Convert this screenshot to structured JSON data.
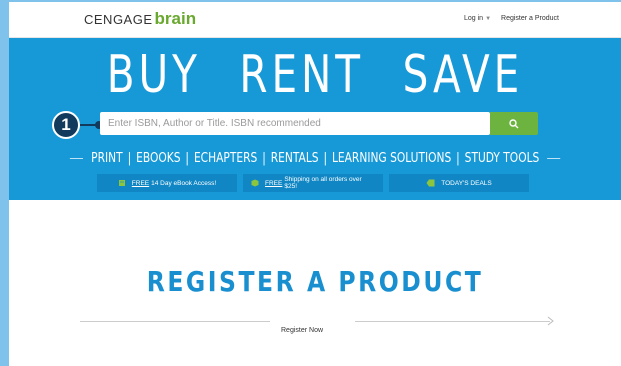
{
  "header": {
    "logo_part1": "CENGAGE",
    "logo_part2": "brain",
    "login_label": "Log in",
    "register_label": "Register a Product"
  },
  "hero": {
    "title": "BUY RENT SAVE",
    "step_number": "1",
    "search": {
      "placeholder": "Enter ISBN, Author or Title. ISBN recommended",
      "value": "",
      "button_icon": "search-icon"
    },
    "nav": [
      {
        "label": "PRINT"
      },
      {
        "label": "EBOOKS"
      },
      {
        "label": "ECHAPTERS"
      },
      {
        "label": "RENTALS"
      },
      {
        "label": "LEARNING SOLUTIONS"
      },
      {
        "label": "STUDY TOOLS"
      }
    ],
    "nav_separator": "|",
    "promos": [
      {
        "icon": "book-icon",
        "highlight": "FREE",
        "text": "14 Day eBook Access!"
      },
      {
        "icon": "box-icon",
        "highlight": "FREE",
        "text": "Shipping on all orders over $25!"
      },
      {
        "icon": "tag-icon",
        "highlight": "",
        "text": "TODAY'S DEALS"
      }
    ]
  },
  "register": {
    "title": "REGISTER A PRODUCT",
    "link_label": "Register Now"
  },
  "colors": {
    "hero_bg": "#1799d8",
    "accent_green": "#6db33f",
    "title_blue": "#1a8fd0",
    "frame_blue": "#7fc3ec"
  }
}
